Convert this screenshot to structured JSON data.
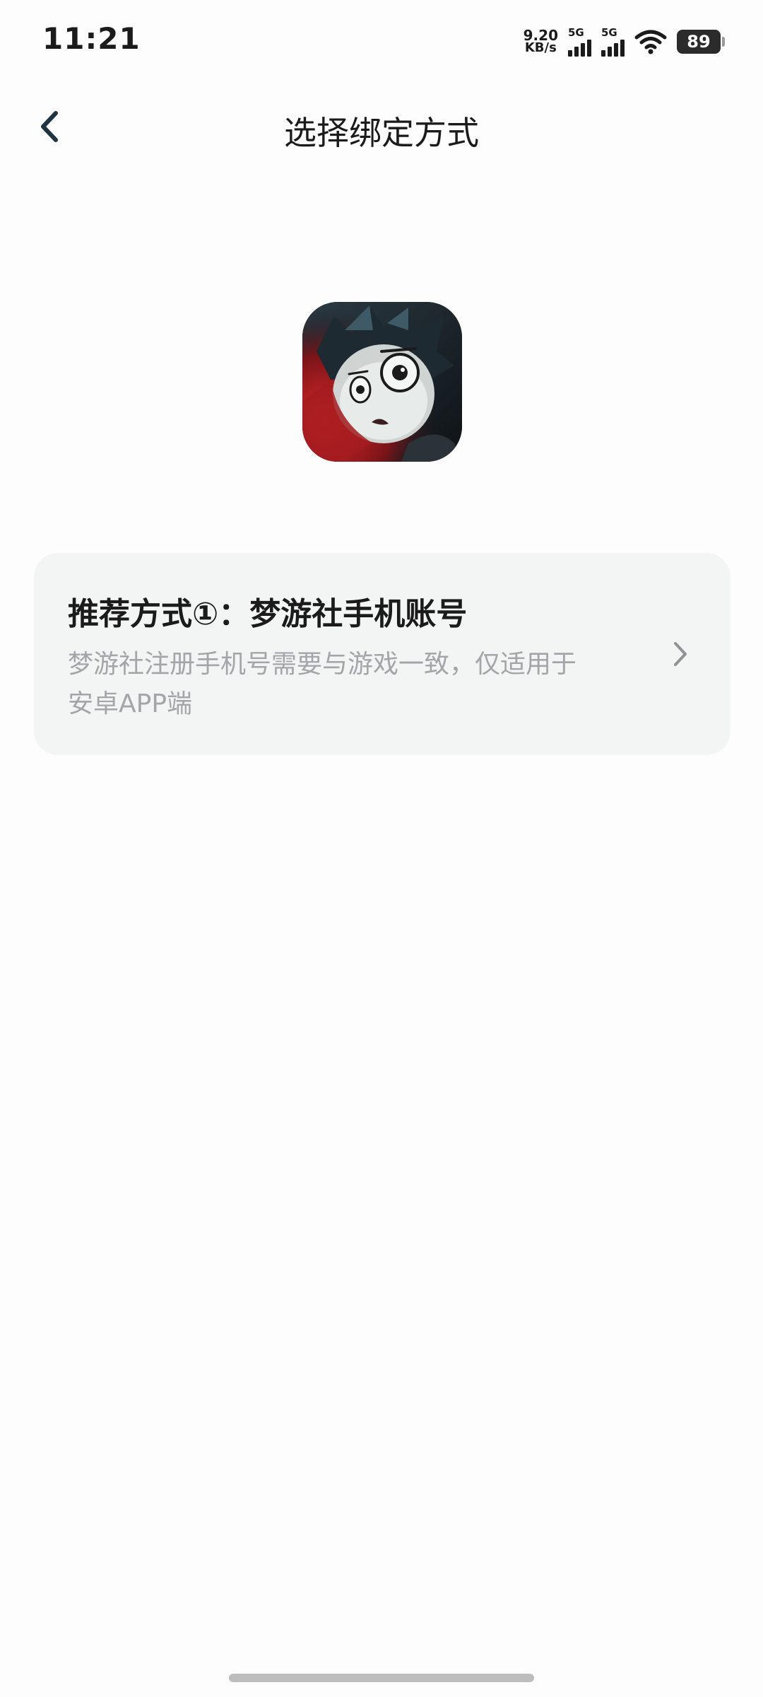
{
  "status_bar": {
    "time": "11:21",
    "net_speed_value": "9.20",
    "net_speed_unit": "KB/s",
    "signal_1_label": "5G",
    "signal_2_label": "5G",
    "battery_level": "89"
  },
  "header": {
    "title": "选择绑定方式",
    "back_icon": "chevron-left-icon"
  },
  "game_icon": {
    "name": "game-app-icon"
  },
  "option": {
    "title": "推荐方式①：梦游社手机账号",
    "description": "梦游社注册手机号需要与游戏一致，仅适用于安卓APP端",
    "chevron_icon": "chevron-right-icon"
  },
  "colors": {
    "card_bg": "#f3f4f4",
    "desc_text": "#a3a6a8",
    "primary_text": "#1b1b1b",
    "back_arrow": "#1f3443"
  }
}
